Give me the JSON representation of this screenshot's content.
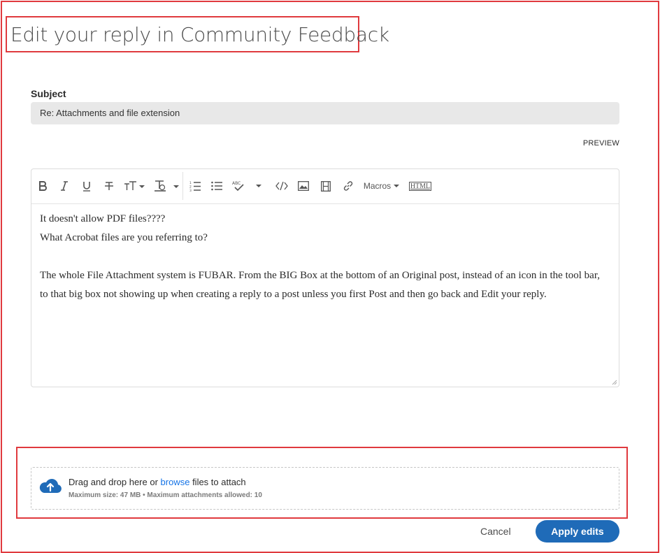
{
  "page": {
    "title": "Edit your reply in Community Feedback"
  },
  "subject": {
    "label": "Subject",
    "value": "Re: Attachments and file extension"
  },
  "preview_label": "PREVIEW",
  "toolbar": {
    "macros_label": "Macros",
    "html_label": "HTML",
    "tools": [
      "bold-icon",
      "italic-icon",
      "underline-icon",
      "strikethrough-icon",
      "font-size-icon",
      "text-color-icon",
      "ordered-list-icon",
      "bullet-list-icon",
      "spellcheck-icon",
      "code-icon",
      "image-icon",
      "video-icon",
      "link-icon"
    ]
  },
  "editor": {
    "lines": [
      "It doesn't allow PDF files????",
      "What Acrobat files are you referring to?",
      "",
      "The whole File Attachment system is FUBAR. From the BIG Box at the bottom of an Original post, instead of an icon in the tool bar, to that big box not showing up when creating a reply to a post unless you first Post and then go back and Edit your reply."
    ]
  },
  "attachments": {
    "drop_prefix": "Drag and drop here or ",
    "browse_link": "browse",
    "drop_suffix": " files to attach",
    "limits": "Maximum size: 47 MB • Maximum attachments allowed: 10"
  },
  "actions": {
    "cancel": "Cancel",
    "apply": "Apply edits"
  },
  "colors": {
    "accent": "#1f6bb8",
    "highlight": "#e03a3e",
    "link": "#1473e6"
  }
}
